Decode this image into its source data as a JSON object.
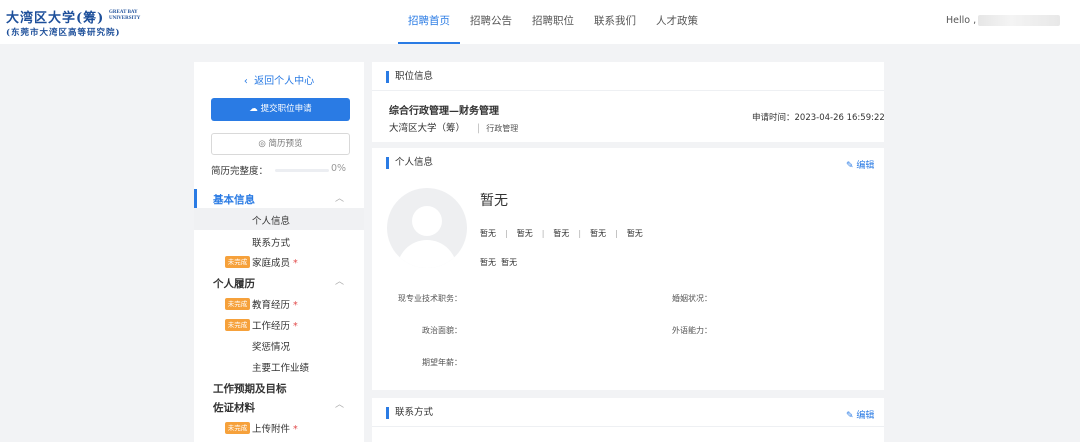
{
  "header": {
    "logo": {
      "cn_main": "大湾区大学(筹)",
      "en_line1": "GREAT BAY",
      "en_line2": "UNIVERSITY",
      "cn_sub": "(东莞市大湾区高等研究院)"
    },
    "nav": [
      "招聘首页",
      "招聘公告",
      "招聘职位",
      "联系我们",
      "人才政策"
    ],
    "active_nav": "招聘首页",
    "greeting": "Hello ,"
  },
  "sidebar": {
    "back_label": "返回个人中心",
    "submit_label": "提交职位申请",
    "preview_label": "简历预览",
    "progress_label": "简历完整度：",
    "progress_value": "0%",
    "progress_fraction": 0,
    "sections": {
      "basic": {
        "title": "基本信息",
        "items": [
          "个人信息",
          "联系方式",
          "家庭成员"
        ]
      },
      "resume": {
        "title": "个人履历",
        "items": [
          "教育经历",
          "工作经历",
          "奖惩情况",
          "主要工作业绩"
        ]
      },
      "goals": {
        "title": "工作预期及目标"
      },
      "materials": {
        "title": "佐证材料",
        "items": [
          "上传附件"
        ]
      }
    },
    "incomplete_tag": "未完成",
    "required_mark": "*"
  },
  "job": {
    "card_title": "职位信息",
    "title": "综合行政管理—财务管理",
    "org": "大湾区大学（筹）",
    "separator": "|",
    "dept": "行政管理",
    "apply_time": "申请时间：2023-04-26 16:59:22"
  },
  "personal": {
    "card_title": "个人信息",
    "edit_label": "编辑",
    "name": "暂无",
    "row1": [
      "暂无",
      "暂无",
      "暂无",
      "暂无",
      "暂无"
    ],
    "row1_sep": "|",
    "row2": [
      "暂无",
      "暂无"
    ],
    "fields": {
      "title": "现专业技术职务：",
      "marital": "婚姻状况：",
      "political": "政治面貌：",
      "language": "外语能力：",
      "salary": "期望年薪："
    }
  },
  "contact": {
    "card_title": "联系方式",
    "edit_label": "编辑"
  },
  "colors": {
    "accent": "#2a7be4",
    "tag": "#f6a13b",
    "required": "#e24b4b",
    "background": "#f2f3f5"
  }
}
